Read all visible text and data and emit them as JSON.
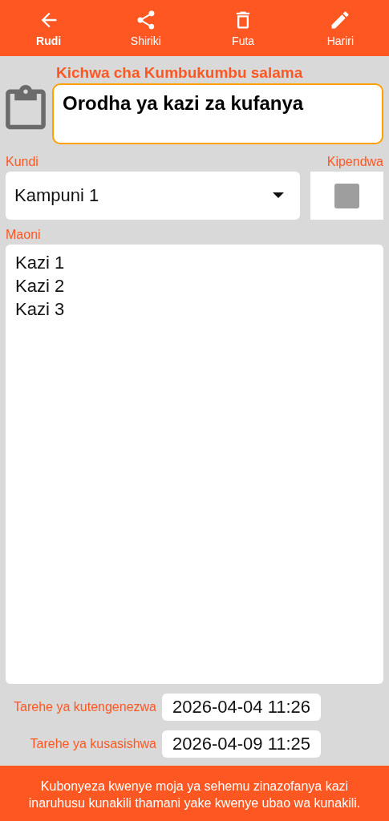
{
  "toolbar": [
    {
      "kind": "back",
      "label": "Rudi",
      "selected": true
    },
    {
      "kind": "share",
      "label": "Shiriki",
      "selected": false
    },
    {
      "kind": "delete",
      "label": "Futa",
      "selected": false
    },
    {
      "kind": "edit",
      "label": "Hariri",
      "selected": false
    }
  ],
  "title_label": "Kichwa cha Kumbukumbu salama",
  "title_value": "Orodha ya kazi za kufanya",
  "group": {
    "label": "Kundi",
    "value": "Kampuni 1"
  },
  "favorite": {
    "label": "Kipendwa",
    "checked": false
  },
  "notes": {
    "label": "Maoni",
    "value": "Kazi 1\nKazi 2\nKazi 3"
  },
  "dates": [
    {
      "label": "Tarehe ya kutengenezwa",
      "value": "2026-04-04 11:26"
    },
    {
      "label": "Tarehe ya kusasishwa",
      "value": "2026-04-09 11:25"
    }
  ],
  "footer": "Kubonyeza kwenye moja ya sehemu zinazofanya kazi inaruhusu kunakili thamani yake kwenye ubao wa kunakili."
}
